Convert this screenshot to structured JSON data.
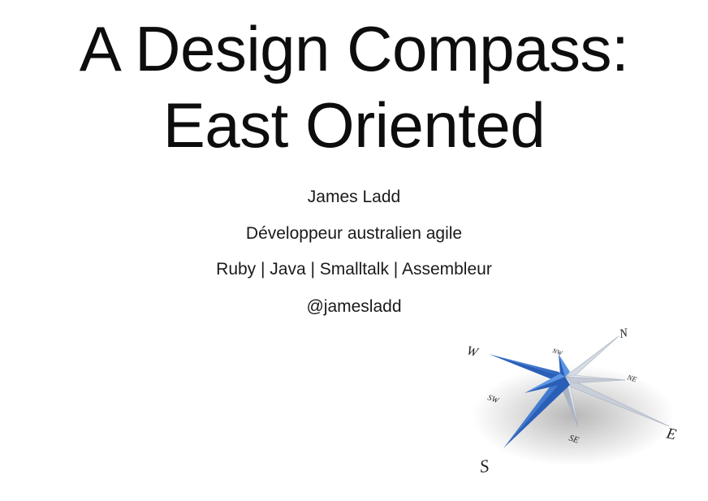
{
  "slide": {
    "title_line1": "A Design Compass:",
    "title_line2": "East Oriented",
    "author": "James Ladd",
    "role": "Développeur australien agile",
    "languages": "Ruby | Java | Smalltalk | Assembleur",
    "handle": "@jamesladd"
  },
  "compass": {
    "icon": "compass-rose-icon",
    "labels": {
      "n": "N",
      "ne": "NE",
      "e": "E",
      "se": "SE",
      "s": "S",
      "sw": "SW",
      "w": "W",
      "nw": "NW"
    },
    "colors": {
      "blue": "#3a78d6",
      "blue_dark": "#2a5fb8",
      "silver": "#e3e7ee",
      "silver_dark": "#b8c0cc"
    }
  }
}
